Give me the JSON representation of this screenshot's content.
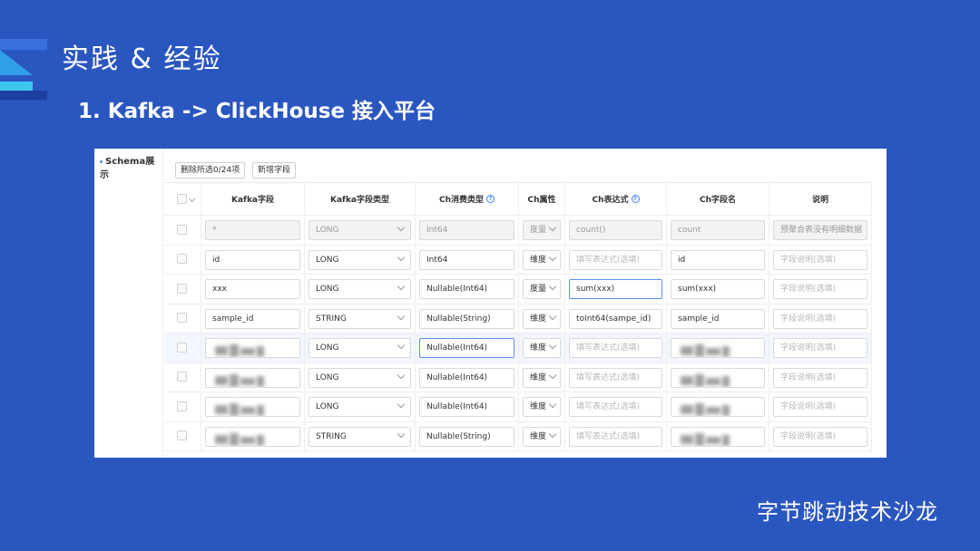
{
  "slide": {
    "title": "实践 & 经验",
    "subtitle": "1. Kafka -> ClickHouse 接入平台",
    "brand": "字节跳动技术沙龙"
  },
  "panel": {
    "section_label": "Schema展示",
    "delete_button": "删除所选0/24项",
    "add_button": "新增字段"
  },
  "table": {
    "headers": [
      "Kafka字段",
      "Kafka字段类型",
      "Ch消费类型",
      "Ch属性",
      "Ch表达式",
      "Ch字段名",
      "说明"
    ],
    "rows": [
      {
        "kafka_field": "*",
        "kafka_type": "LONG",
        "ch_type": "Int64",
        "attr": "度量",
        "expr": "count()",
        "ch_name": "count",
        "desc": "预聚合表没有明细数据"
      },
      {
        "kafka_field": "id",
        "kafka_type": "LONG",
        "ch_type": "Int64",
        "attr": "维度",
        "expr": "填写表达式(选填)",
        "ch_name": "id",
        "desc": "字段说明(选填)"
      },
      {
        "kafka_field": "xxx",
        "kafka_type": "LONG",
        "ch_type": "Nullable(Int64)",
        "attr": "度量",
        "expr": "sum(xxx)",
        "ch_name": "sum(xxx)",
        "desc": "字段说明(选填)"
      },
      {
        "kafka_field": "sample_id",
        "kafka_type": "STRING",
        "ch_type": "Nullable(String)",
        "attr": "维度",
        "expr": "toInt64(sampe_id)",
        "ch_name": "sample_id",
        "desc": "字段说明(选填)"
      },
      {
        "kafka_field": "",
        "kafka_type": "LONG",
        "ch_type": "Nullable(Int64)",
        "attr": "维度",
        "expr": "填写表达式(选填)",
        "ch_name": "",
        "desc": "字段说明(选填)"
      },
      {
        "kafka_field": "",
        "kafka_type": "LONG",
        "ch_type": "Nullable(Int64)",
        "attr": "维度",
        "expr": "填写表达式(选填)",
        "ch_name": "",
        "desc": "字段说明(选填)"
      },
      {
        "kafka_field": "",
        "kafka_type": "LONG",
        "ch_type": "Nullable(Int64)",
        "attr": "维度",
        "expr": "填写表达式(选填)",
        "ch_name": "",
        "desc": "字段说明(选填)"
      },
      {
        "kafka_field": "",
        "kafka_type": "STRING",
        "ch_type": "Nullable(String)",
        "attr": "维度",
        "expr": "填写表达式(选填)",
        "ch_name": "",
        "desc": "字段说明(选填)"
      }
    ]
  }
}
